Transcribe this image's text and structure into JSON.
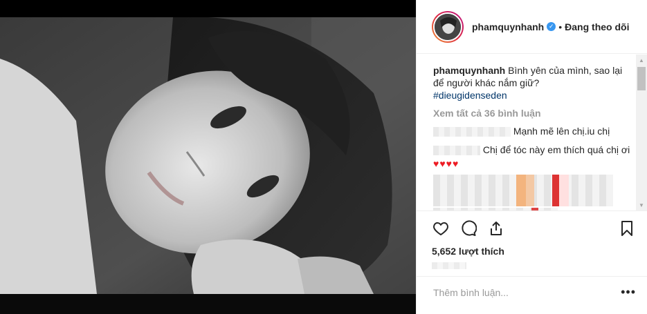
{
  "post": {
    "username": "phamquynhanh",
    "verified_icon": "verified-badge-icon",
    "follow_separator": "•",
    "follow_label": "Đang theo dõi"
  },
  "caption": {
    "username": "phamquynhanh",
    "text": "Bình yên của mình, sao lại để người khác nắm giữ?",
    "hashtag": "#dieugidenseden"
  },
  "view_all_comments": "Xem tất cả 36 bình luận",
  "comments": [
    {
      "text": "Mạnh mẽ lên chị.iu chị"
    },
    {
      "text": "Chị để tóc này em thích quá chị ơi",
      "emoji": "♥♥♥♥"
    }
  ],
  "actions": {
    "like_icon": "heart-icon",
    "comment_icon": "comment-icon",
    "share_icon": "share-icon",
    "save_icon": "bookmark-icon"
  },
  "likes": "5,652 lượt thích",
  "add_comment": {
    "placeholder": "Thêm bình luận...",
    "more": "•••"
  }
}
